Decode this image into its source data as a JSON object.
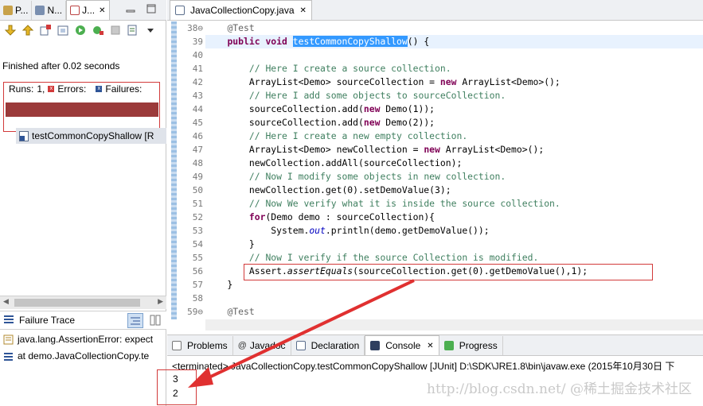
{
  "left_panel": {
    "tabs": [
      {
        "label": "P..."
      },
      {
        "label": "N..."
      },
      {
        "label": "J..."
      }
    ],
    "finished_text": "Finished after 0.02 seconds",
    "runs_label": "Runs:",
    "runs_value": "1,",
    "errors_label": "Errors:",
    "failures_label": "Failures:",
    "progress_color": "#9b3a3a",
    "test_item": "testCommonCopyShallow [R",
    "failure_trace_label": "Failure Trace",
    "trace_lines": [
      "java.lang.AssertionError: expect",
      "at demo.JavaCollectionCopy.te"
    ]
  },
  "editor": {
    "tab_title": "JavaCollectionCopy.java",
    "close_symbol": "✕",
    "line_numbers": [
      "38⊖",
      "39",
      "40",
      "41",
      "42",
      "43",
      "44",
      "45",
      "46",
      "47",
      "48",
      "49",
      "50",
      "51",
      "52",
      "53",
      "54",
      "55",
      "56",
      "57",
      "58",
      "59⊖"
    ]
  },
  "console": {
    "tabs": [
      {
        "label": "Problems"
      },
      {
        "label": "Javadoc"
      },
      {
        "label": "Declaration"
      },
      {
        "label": "Console"
      },
      {
        "label": "Progress"
      }
    ],
    "terminated_text": "<terminated> JavaCollectionCopy.testCommonCopyShallow [JUnit] D:\\SDK\\JRE1.8\\bin\\javaw.exe (2015年10月30日 下",
    "output": [
      "3",
      "2"
    ]
  },
  "watermark": "http://blog.csdn.net/ @稀土掘金技术社区",
  "colors": {
    "highlight_box": "#d23a3a",
    "keyword": "#7f0055",
    "comment": "#3f7f5f",
    "selection": "#3399ff"
  }
}
